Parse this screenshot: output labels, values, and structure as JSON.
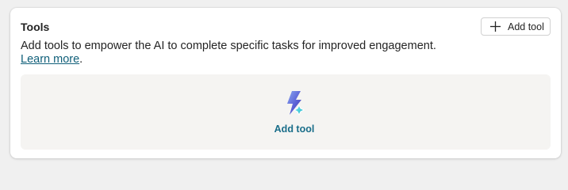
{
  "tools_card": {
    "title": "Tools",
    "add_button_label": "Add tool",
    "description_text": "Add tools to empower the AI to complete specific tasks for improved engagement. ",
    "learn_more_label": "Learn more",
    "description_end": ".",
    "empty_state": {
      "action_label": "Add tool"
    }
  },
  "colors": {
    "link": "#11607a",
    "accent": "#1a6e8a",
    "panel_background": "#f5f4f2"
  },
  "icons": {
    "add_button_icon": "plus-icon",
    "empty_state_icon": "lightning-bolt-icon"
  }
}
